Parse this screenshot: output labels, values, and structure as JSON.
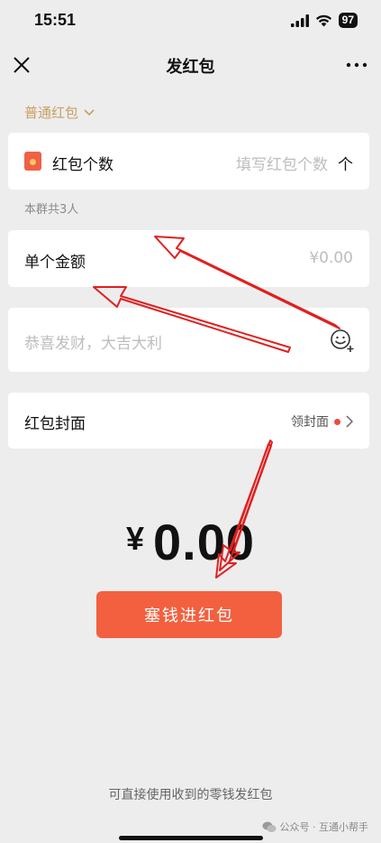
{
  "status_bar": {
    "time": "15:51",
    "battery": "97"
  },
  "nav": {
    "title": "发红包"
  },
  "packet_type": {
    "label": "普通红包"
  },
  "count_row": {
    "label": "红包个数",
    "placeholder": "填写红包个数",
    "unit": "个"
  },
  "group_hint": "本群共3人",
  "amount_row": {
    "label": "单个金额",
    "placeholder": "¥0.00"
  },
  "greeting_row": {
    "placeholder": "恭喜发财，大吉大利"
  },
  "cover_row": {
    "label": "红包封面",
    "link": "领封面"
  },
  "total": {
    "currency": "¥",
    "value": "0.00"
  },
  "submit_button": {
    "label": "塞钱进红包"
  },
  "footer_tip": "可直接使用收到的零钱发红包",
  "watermark": "公众号 · 互通小帮手",
  "colors": {
    "accent": "#f2603f",
    "gold": "#c8a062",
    "annotation": "#e02020"
  }
}
